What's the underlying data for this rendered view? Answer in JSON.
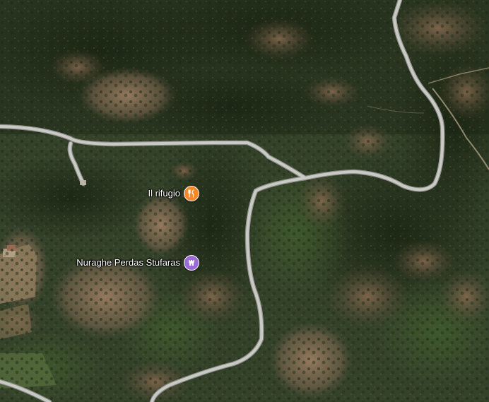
{
  "map": {
    "type": "satellite",
    "colors": {
      "road": "#c9c9c6",
      "road_edge": "#8d8e88",
      "restaurant_pin": "#f28a2b",
      "attraction_pin": "#9b6cd7"
    }
  },
  "pois": [
    {
      "label": "Il rifugio",
      "category": "restaurant",
      "icon": "fork-knife-icon"
    },
    {
      "label": "Nuraghe Perdas Stufaras",
      "category": "attraction",
      "icon": "tower-icon"
    }
  ]
}
